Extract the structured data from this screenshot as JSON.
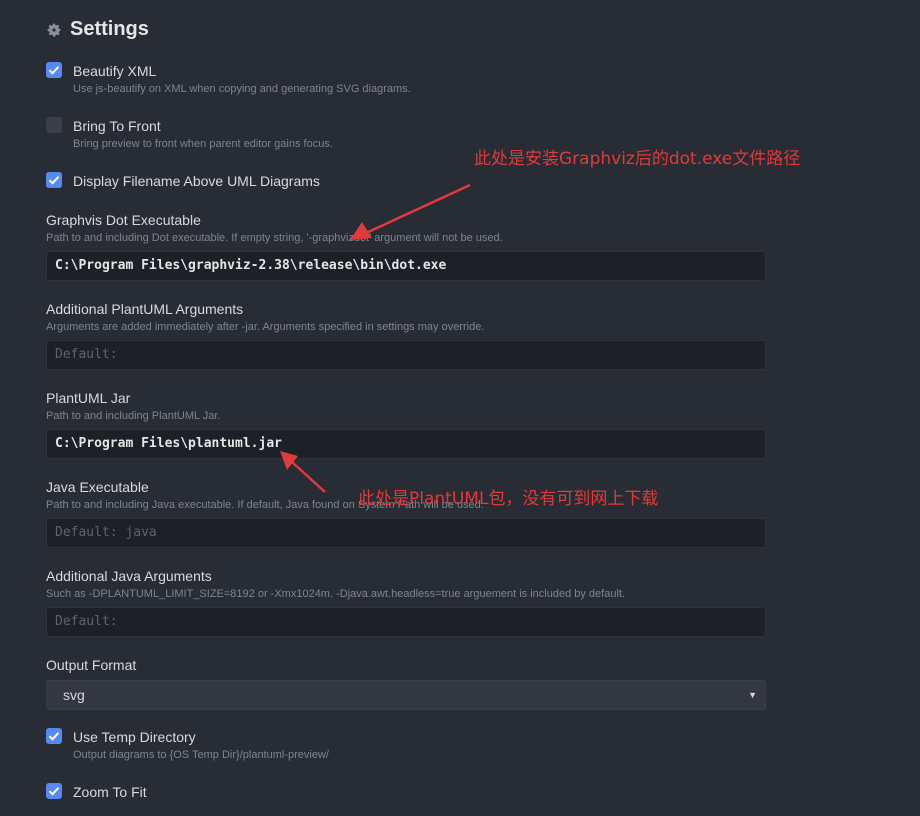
{
  "header": {
    "title": "Settings",
    "icon": "gear-icon"
  },
  "settings": {
    "beautify": {
      "label": "Beautify XML",
      "desc": "Use js-beautify on XML when copying and generating SVG diagrams.",
      "checked": true
    },
    "bring_front": {
      "label": "Bring To Front",
      "desc": "Bring preview to front when parent editor gains focus.",
      "checked": false
    },
    "display_filename": {
      "label": "Display Filename Above UML Diagrams",
      "checked": true
    },
    "dot_exe": {
      "label": "Graphvis Dot Executable",
      "desc": "Path to and including Dot executable. If empty string, '-graphvizdot' argument will not be used.",
      "value": "C:\\Program Files\\graphviz-2.38\\release\\bin\\dot.exe"
    },
    "plantuml_args": {
      "label": "Additional PlantUML Arguments",
      "desc": "Arguments are added immediately after -jar. Arguments specified in settings may override.",
      "placeholder": "Default:"
    },
    "plantuml_jar": {
      "label": "PlantUML Jar",
      "desc": "Path to and including PlantUML Jar.",
      "value": "C:\\Program Files\\plantuml.jar"
    },
    "java_exe": {
      "label": "Java Executable",
      "desc": "Path to and including Java executable. If default, Java found on System Path will be used.",
      "placeholder": "Default: java"
    },
    "java_args": {
      "label": "Additional Java Arguments",
      "desc": "Such as -DPLANTUML_LIMIT_SIZE=8192 or -Xmx1024m. -Djava.awt.headless=true arguement is included by default.",
      "placeholder": "Default:"
    },
    "output_format": {
      "label": "Output Format",
      "value": "svg"
    },
    "use_temp": {
      "label": "Use Temp Directory",
      "desc": "Output diagrams to {OS Temp Dir}/plantuml-preview/",
      "checked": true
    },
    "zoom_fit": {
      "label": "Zoom To Fit",
      "checked": true
    }
  },
  "annotations": {
    "dot_note": "此处是安装Graphviz后的dot.exe文件路径",
    "jar_note": "此处是PlantUML包，没有可到网上下载",
    "color": "#e03a3a"
  },
  "colors": {
    "background": "#282c34",
    "accent": "#568af2",
    "input_bg": "#1d2026"
  }
}
